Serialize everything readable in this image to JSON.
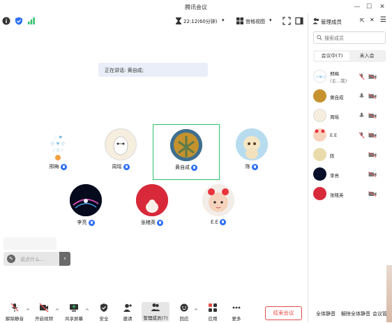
{
  "window": {
    "title": "腾讯会议"
  },
  "toolbar": {
    "timer": "22:12(60分钟)",
    "view_label": "宫格视图",
    "info_icon": "info-icon",
    "shield_icon": "shield-icon",
    "signal_icon": "signal-icon"
  },
  "speaking": {
    "text": "正在讲话: 黄自成;"
  },
  "participants_grid": [
    {
      "name": "邢梅"
    },
    {
      "name": "周瑶"
    },
    {
      "name": "黄自成"
    },
    {
      "name": "陈"
    },
    {
      "name": "李亮"
    },
    {
      "name": "张楮英"
    },
    {
      "name": "E.E"
    }
  ],
  "chat": {
    "placeholder": "说点什么..."
  },
  "bottom": {
    "mute": "解除静音",
    "video": "开启视频",
    "share": "共享屏幕",
    "security": "安全",
    "invite": "邀请",
    "members": "管理成员(7)",
    "react": "回应",
    "apps": "应用",
    "more": "更多",
    "end": "结束会议"
  },
  "panel": {
    "title": "管理成员",
    "search_placeholder": "搜索成员",
    "tab_in": "会议中(7)",
    "tab_out": "未入会",
    "members": [
      {
        "name": "邢梅",
        "sub": "(主...我)"
      },
      {
        "name": "黄自成"
      },
      {
        "name": "周瑶"
      },
      {
        "name": "E.E"
      },
      {
        "name": "陈"
      },
      {
        "name": "李亮"
      },
      {
        "name": "张楮英"
      }
    ],
    "mute_all": "全体静音",
    "unmute_all": "解除全体静音",
    "settings": "会议管"
  },
  "colors": {
    "accent": "#2d6ef5",
    "active_border": "#2ec26a",
    "end_red": "#e64b4b"
  }
}
